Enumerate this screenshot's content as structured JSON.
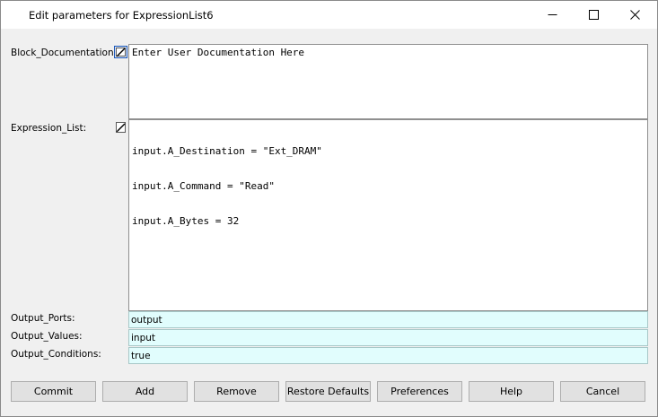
{
  "window": {
    "title": "Edit parameters for ExpressionList6"
  },
  "params": {
    "block_documentation": {
      "label": "Block_Documentation:",
      "value": "Enter User Documentation Here"
    },
    "expression_list": {
      "label": "Expression_List:",
      "lines": [
        "input.A_Destination = \"Ext_DRAM\"",
        "input.A_Command = \"Read\"",
        "input.A_Bytes = 32"
      ]
    },
    "output_ports": {
      "label": "Output_Ports:",
      "value": "output"
    },
    "output_values": {
      "label": "Output_Values:",
      "value": "input"
    },
    "output_conditions": {
      "label": "Output_Conditions:",
      "value": "true"
    }
  },
  "buttons": {
    "commit": "Commit",
    "add": "Add",
    "remove": "Remove",
    "restore_defaults": "Restore Defaults",
    "preferences": "Preferences",
    "help": "Help",
    "cancel": "Cancel"
  },
  "icons": {
    "minimize": "minimize-icon",
    "maximize": "maximize-icon",
    "close": "close-icon",
    "edit": "edit-document-icon"
  },
  "colors": {
    "field_background": "#e1fdfd",
    "button_background": "#e1e1e1"
  }
}
